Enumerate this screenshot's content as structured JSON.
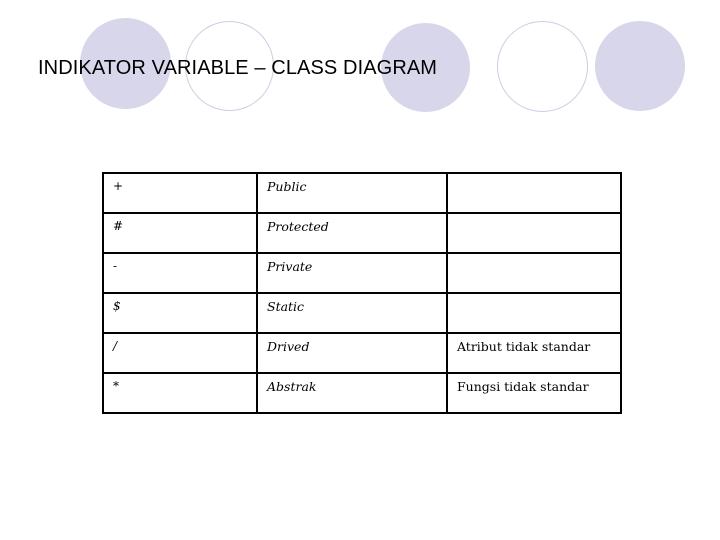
{
  "slide": {
    "title": "INDIKATOR VARIABLE – CLASS DIAGRAM",
    "background_color": "#FFFFFF",
    "text_color": "#000000"
  },
  "decoration": {
    "accent_color": "#D8D6EA",
    "outline_color": "#CECCE3",
    "circles": [
      {
        "name": "circle-1",
        "style": "filled"
      },
      {
        "name": "circle-2",
        "style": "outlined"
      },
      {
        "name": "circle-3",
        "style": "filled"
      },
      {
        "name": "circle-4",
        "style": "outlined"
      },
      {
        "name": "circle-5",
        "style": "filled"
      }
    ]
  },
  "table": {
    "border_color": "#000000",
    "columns": [
      "symbol",
      "meaning",
      "note"
    ],
    "rows": [
      {
        "symbol": "+",
        "meaning": "Public",
        "note": ""
      },
      {
        "symbol": "#",
        "meaning": "Protected",
        "note": ""
      },
      {
        "symbol": "-",
        "meaning": "Private",
        "note": ""
      },
      {
        "symbol": "$",
        "meaning": "Static",
        "note": ""
      },
      {
        "symbol": "/",
        "meaning": "Drived",
        "note": "Atribut tidak standar"
      },
      {
        "symbol": "*",
        "meaning": "Abstrak",
        "note": "Fungsi tidak standar"
      }
    ]
  }
}
